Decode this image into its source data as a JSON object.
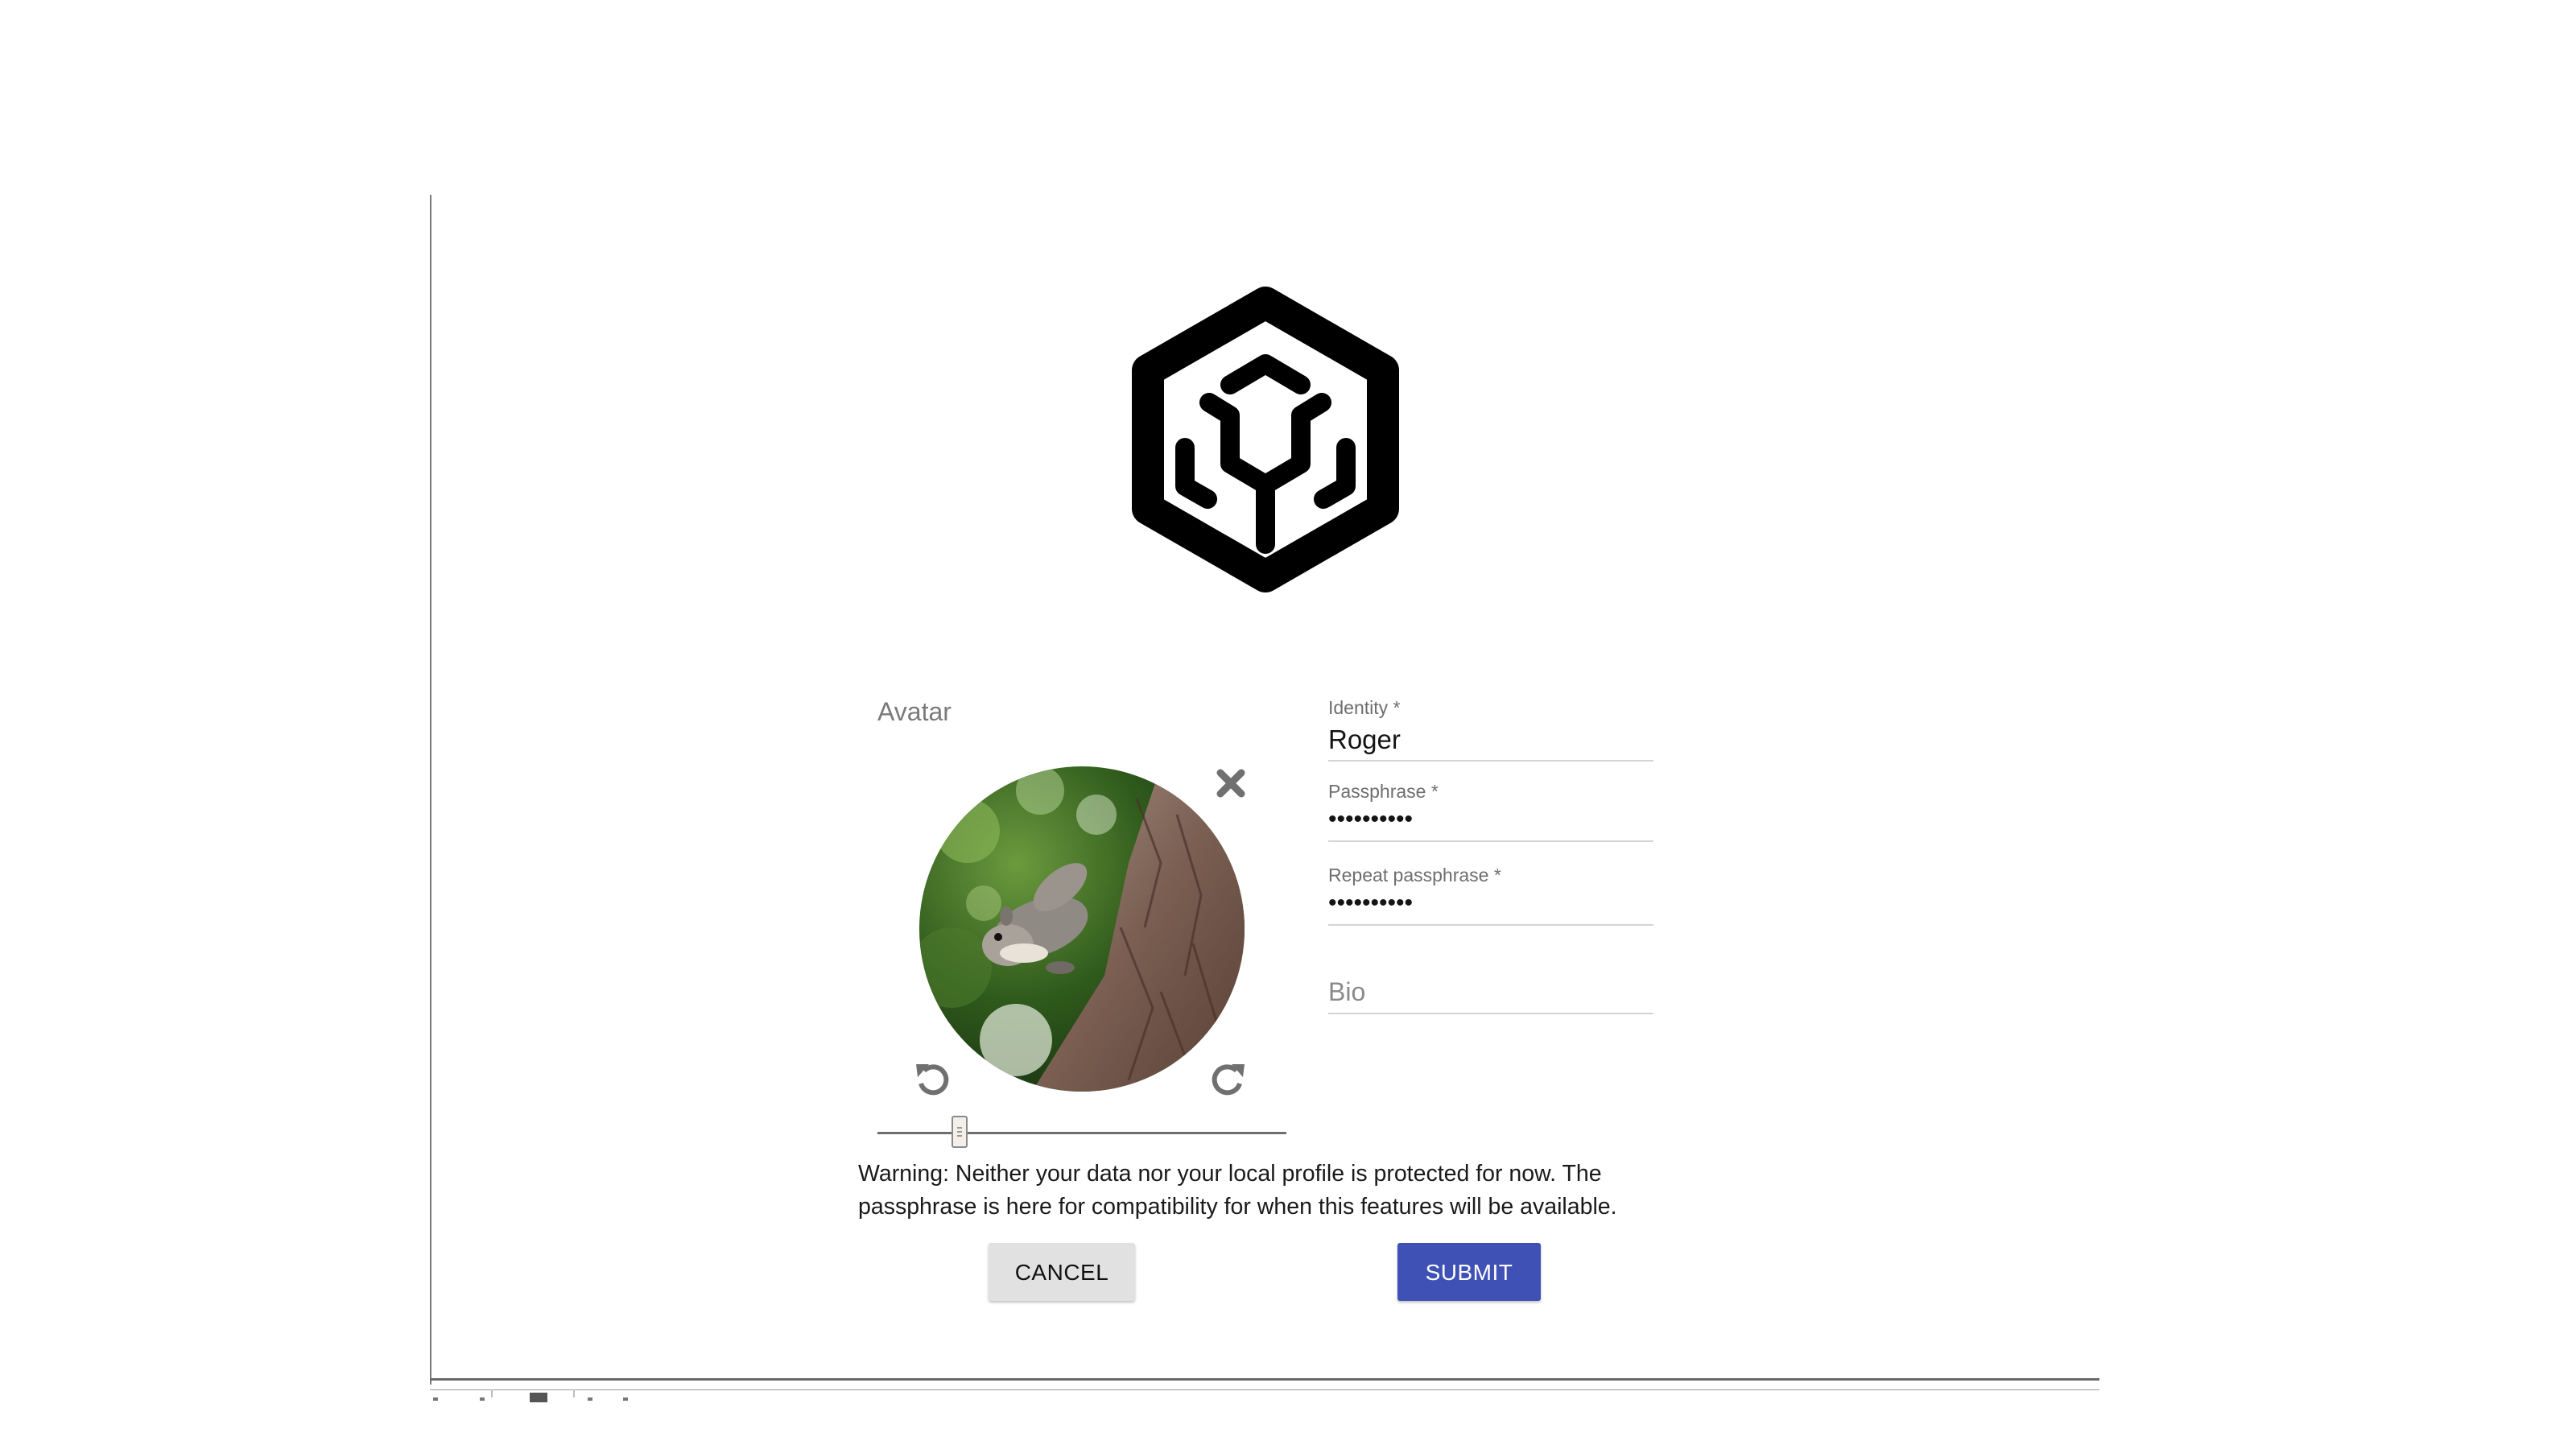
{
  "avatar": {
    "label": "Avatar",
    "zoom_level": 0.2
  },
  "form": {
    "identity_label": "Identity *",
    "identity_value": "Roger",
    "passphrase_label": "Passphrase *",
    "passphrase_value": "••••••••••",
    "repeat_label": "Repeat passphrase *",
    "repeat_value": "••••••••••",
    "bio_placeholder": "Bio"
  },
  "warning_text": "Warning: Neither your data nor your local profile is protected for now. The passphrase is here for compatibility for when this features will be available.",
  "buttons": {
    "cancel_label": "CANCEL",
    "submit_label": "SUBMIT"
  },
  "colors": {
    "submit_bg": "#3f51b5",
    "cancel_bg": "#e1e1e1"
  },
  "icons": {
    "logo": "hexagon-logo-icon",
    "remove": "close-icon",
    "rotate_left": "rotate-left-icon",
    "rotate_right": "rotate-right-icon"
  }
}
